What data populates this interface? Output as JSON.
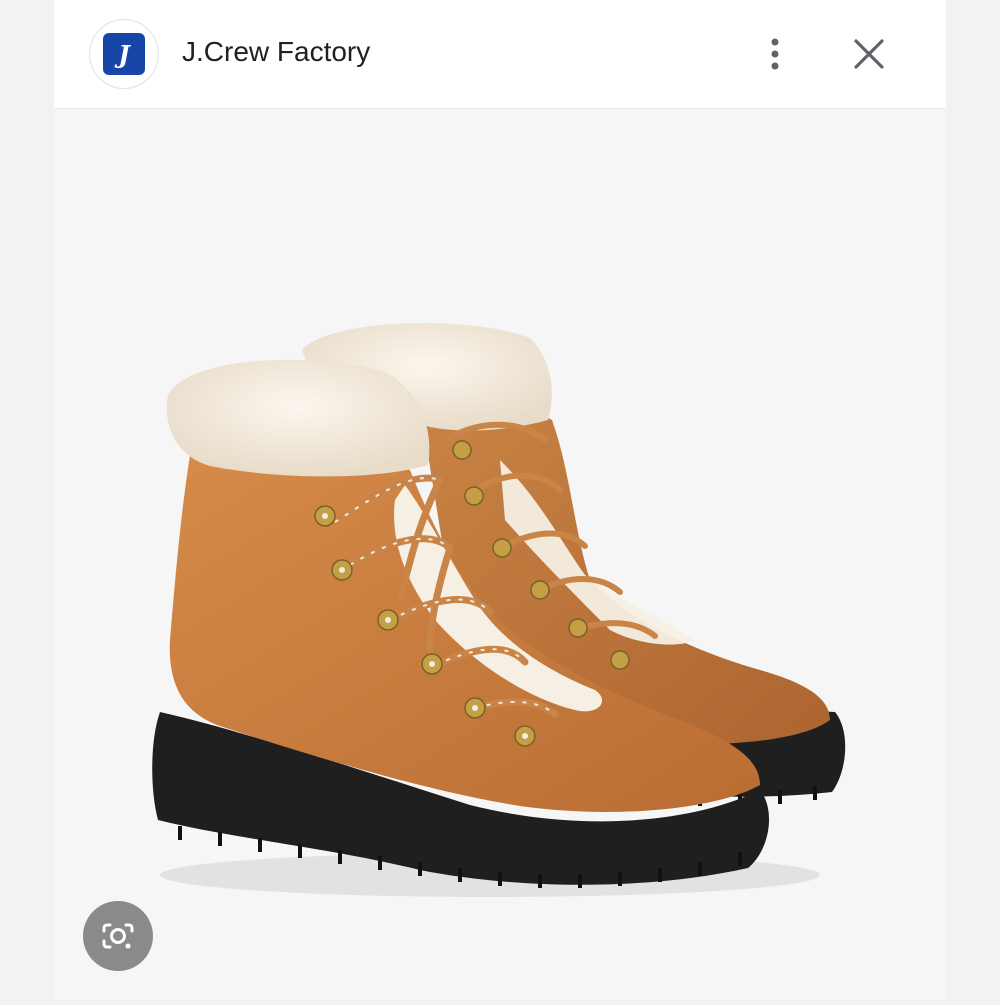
{
  "header": {
    "site_title": "J.Crew Factory",
    "logo_letter": "J",
    "logo_color": "#1746a8",
    "menu_icon": "more-vert-icon",
    "close_icon": "close-icon"
  },
  "image": {
    "subject": "boots-icon",
    "boot_color": "#c97a3f",
    "fur_color": "#efe5d7",
    "sole_color": "#202020",
    "hardware_color": "#c59f45"
  },
  "lens": {
    "icon": "lens-icon"
  }
}
